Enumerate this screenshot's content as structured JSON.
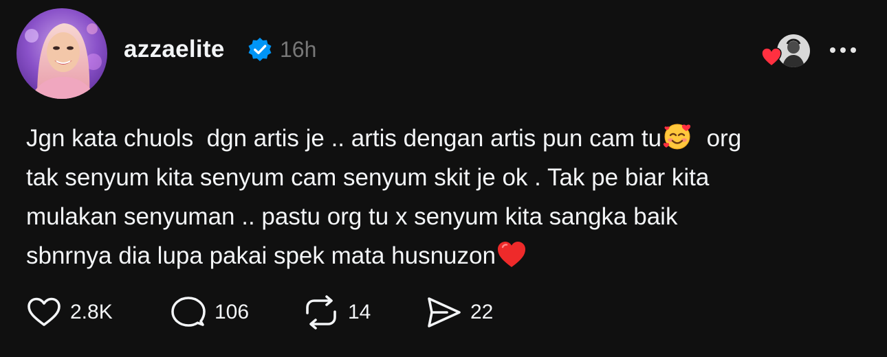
{
  "post": {
    "username": "azzaelite",
    "verified": true,
    "timestamp": "16h",
    "text_lines": [
      "Jgn kata chuols  dgn artis je .. artis dengan artis pun cam tu",
      "org",
      "tak senyum kita senyum cam senyum skit je ok . Tak pe biar kita",
      "mulakan senyuman .. pastu org tu x senyum kita sangka baik",
      "sbnrnya dia lupa pakai spek mata husnuzon"
    ],
    "emojis": [
      "smiling-face-with-hearts",
      "red-heart"
    ],
    "actions": {
      "likes": "2.8K",
      "replies": "106",
      "reposts": "14",
      "shares": "22"
    }
  },
  "icons": {
    "verified": "verified-badge-icon",
    "more": "more-options-icon",
    "like": "heart-outline-icon",
    "reply": "comment-bubble-icon",
    "repost": "repost-arrows-icon",
    "share": "send-icon",
    "liker_heart": "red-heart-icon"
  },
  "colors": {
    "background": "#101010",
    "text": "#f3f5f7",
    "muted": "#777777",
    "verified_blue": "#0095f6",
    "heart_red": "#ff3040"
  }
}
